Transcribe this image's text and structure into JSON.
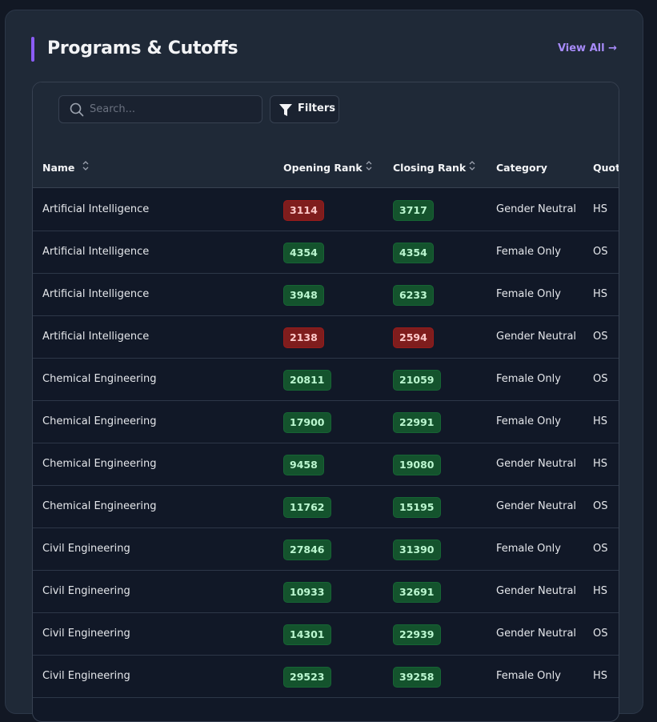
{
  "header": {
    "title": "Programs & Cutoffs",
    "view_all": "View All →",
    "accent": "#8b5cf6"
  },
  "toolbar": {
    "search_placeholder": "Search...",
    "filters_label": "Filters"
  },
  "columns": [
    "Name",
    "Opening Rank",
    "Closing Rank",
    "Category",
    "Quota"
  ],
  "rows": [
    {
      "name": "Artificial Intelligence",
      "opening": "3114",
      "opening_status": "red",
      "closing": "3717",
      "closing_status": "green",
      "category": "Gender Neutral",
      "quota": "HS"
    },
    {
      "name": "Artificial Intelligence",
      "opening": "4354",
      "opening_status": "green",
      "closing": "4354",
      "closing_status": "green",
      "category": "Female Only",
      "quota": "OS"
    },
    {
      "name": "Artificial Intelligence",
      "opening": "3948",
      "opening_status": "green",
      "closing": "6233",
      "closing_status": "green",
      "category": "Female Only",
      "quota": "HS"
    },
    {
      "name": "Artificial Intelligence",
      "opening": "2138",
      "opening_status": "red",
      "closing": "2594",
      "closing_status": "red",
      "category": "Gender Neutral",
      "quota": "OS"
    },
    {
      "name": "Chemical Engineering",
      "opening": "20811",
      "opening_status": "green",
      "closing": "21059",
      "closing_status": "green",
      "category": "Female Only",
      "quota": "OS"
    },
    {
      "name": "Chemical Engineering",
      "opening": "17900",
      "opening_status": "green",
      "closing": "22991",
      "closing_status": "green",
      "category": "Female Only",
      "quota": "HS"
    },
    {
      "name": "Chemical Engineering",
      "opening": "9458",
      "opening_status": "green",
      "closing": "19080",
      "closing_status": "green",
      "category": "Gender Neutral",
      "quota": "HS"
    },
    {
      "name": "Chemical Engineering",
      "opening": "11762",
      "opening_status": "green",
      "closing": "15195",
      "closing_status": "green",
      "category": "Gender Neutral",
      "quota": "OS"
    },
    {
      "name": "Civil Engineering",
      "opening": "27846",
      "opening_status": "green",
      "closing": "31390",
      "closing_status": "green",
      "category": "Female Only",
      "quota": "OS"
    },
    {
      "name": "Civil Engineering",
      "opening": "10933",
      "opening_status": "green",
      "closing": "32691",
      "closing_status": "green",
      "category": "Gender Neutral",
      "quota": "HS"
    },
    {
      "name": "Civil Engineering",
      "opening": "14301",
      "opening_status": "green",
      "closing": "22939",
      "closing_status": "green",
      "category": "Gender Neutral",
      "quota": "OS"
    },
    {
      "name": "Civil Engineering",
      "opening": "29523",
      "opening_status": "green",
      "closing": "39258",
      "closing_status": "green",
      "category": "Female Only",
      "quota": "HS"
    }
  ],
  "icons": {
    "search": "search-icon",
    "filters": "funnel-icon",
    "sort": "sort-icon"
  }
}
